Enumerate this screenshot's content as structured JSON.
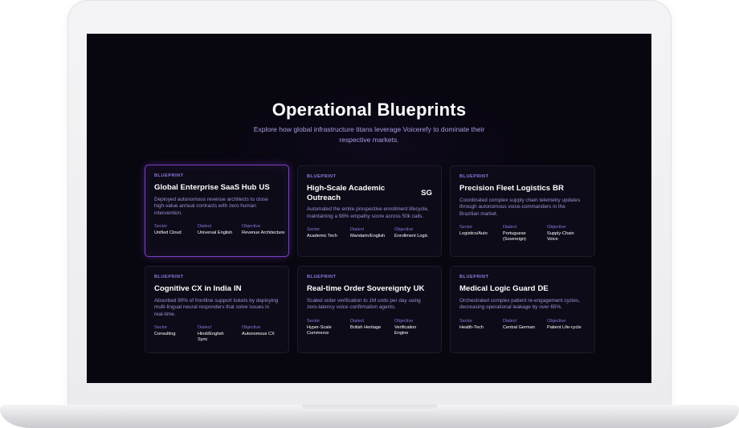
{
  "page": {
    "title": "Operational Blueprints",
    "subtitle": "Explore how global infrastructure titans leverage Voicerefy to dominate their respective markets."
  },
  "labels": {
    "sector": "Sector",
    "dialect": "Dialect",
    "objective": "Objective"
  },
  "cards": [
    {
      "badge": "BLUEPRINT",
      "title": "Global Enterprise SaaS Hub",
      "code": "US",
      "description": "Deployed autonomous revenue architects to close high-value annual contracts with zero human intervention.",
      "sector": "Unified Cloud",
      "dialect": "Universal English",
      "objective": "Revenue Architecture",
      "active": true
    },
    {
      "badge": "BLUEPRINT",
      "title": "High-Scale Academic Outreach",
      "code": "SG",
      "description": "Automated the entire prospective enrollment lifecycle, maintaining a 98% empathy score across 50k calls.",
      "sector": "Academic Tech",
      "dialect": "Mandarin/English",
      "objective": "Enrollment Logic",
      "active": false
    },
    {
      "badge": "BLUEPRINT",
      "title": "Precision Fleet Logistics",
      "code": "BR",
      "description": "Coordinated complex supply chain telemetry updates through autonomous voice-commanders in the Brazilian market.",
      "sector": "Logistics/Auto",
      "dialect": "Portuguese (Sovereign)",
      "objective": "Supply-Chain Voice",
      "active": false
    },
    {
      "badge": "BLUEPRINT",
      "title": "Cognitive CX in India",
      "code": "IN",
      "description": "Absorbed 90% of frontline support tickets by deploying multi-lingual neural responders that solve issues in real-time.",
      "sector": "Consulting",
      "dialect": "Hindi/English Sync",
      "objective": "Autonomous CX",
      "active": false
    },
    {
      "badge": "BLUEPRINT",
      "title": "Real-time Order Sovereignty",
      "code": "UK",
      "description": "Scaled order verification to 1M units per day using zero-latency voice confirmation agents.",
      "sector": "Hyper-Scale Commerce",
      "dialect": "British Heritage",
      "objective": "Verification Engine",
      "active": false
    },
    {
      "badge": "BLUEPRINT",
      "title": "Medical Logic Guard",
      "code": "DE",
      "description": "Orchestrated complex patient re-engagement cycles, decreasing operational leakage by over 65%.",
      "sector": "Health-Tech",
      "dialect": "Central German",
      "objective": "Patient Life-cycle",
      "active": false
    }
  ]
}
